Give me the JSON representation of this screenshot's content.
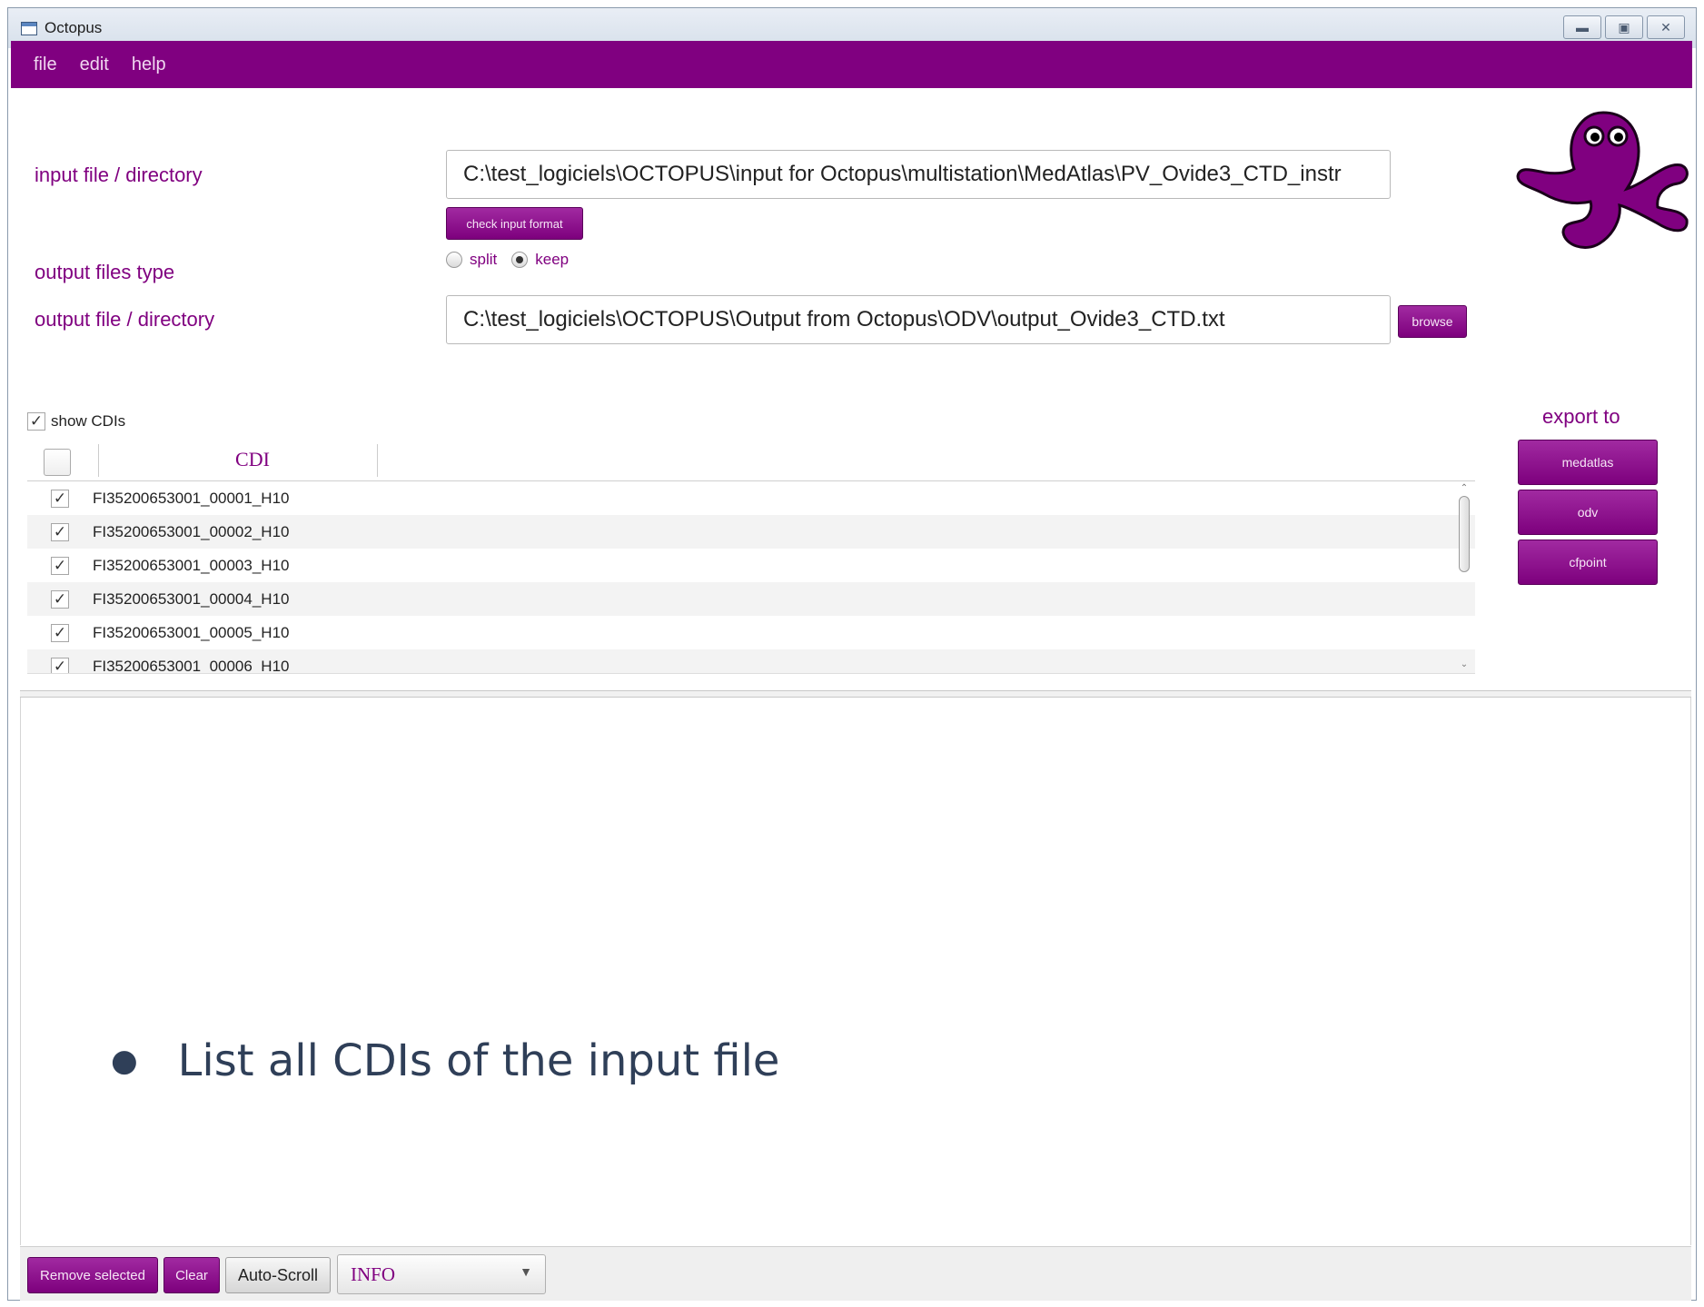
{
  "window": {
    "title": "Octopus",
    "buttons": [
      "minimize",
      "maximize",
      "close"
    ]
  },
  "menu": {
    "items": [
      "file",
      "edit",
      "help"
    ]
  },
  "form": {
    "input_label": "input file / directory",
    "input_value": "C:\\test_logiciels\\OCTOPUS\\input for Octopus\\multistation\\MedAtlas\\PV_Ovide3_CTD_instr",
    "check_button": "check input format",
    "output_type_label": "output files type",
    "output_type_options": [
      "split",
      "keep"
    ],
    "output_type_selected": "keep",
    "output_label": "output file / directory",
    "output_value": "C:\\test_logiciels\\OCTOPUS\\Output from Octopus\\ODV\\output_Ovide3_CTD.txt",
    "browse_button": "browse"
  },
  "cdi": {
    "show_label": "show CDIs",
    "show_checked": true,
    "column_header": "CDI",
    "rows": [
      {
        "name": "FI35200653001_00001_H10",
        "checked": true
      },
      {
        "name": "FI35200653001_00002_H10",
        "checked": true
      },
      {
        "name": "FI35200653001_00003_H10",
        "checked": true
      },
      {
        "name": "FI35200653001_00004_H10",
        "checked": true
      },
      {
        "name": "FI35200653001_00005_H10",
        "checked": true
      },
      {
        "name": "FI35200653001_00006_H10",
        "checked": true
      }
    ]
  },
  "export": {
    "label": "export to",
    "buttons": [
      "medatlas",
      "odv",
      "cfpoint"
    ]
  },
  "log": {
    "bullet_text": "List all CDIs of the input file"
  },
  "bottom": {
    "remove_selected": "Remove selected",
    "clear": "Clear",
    "auto_scroll": "Auto-Scroll",
    "level": "INFO"
  },
  "colors": {
    "accent": "#800080",
    "menubar": "#800080",
    "octopus": "#800080"
  },
  "icons": [
    "window-app-icon",
    "minimize-icon",
    "maximize-icon",
    "close-icon",
    "octopus-logo",
    "checkmark-icon",
    "chevron-down-icon"
  ]
}
